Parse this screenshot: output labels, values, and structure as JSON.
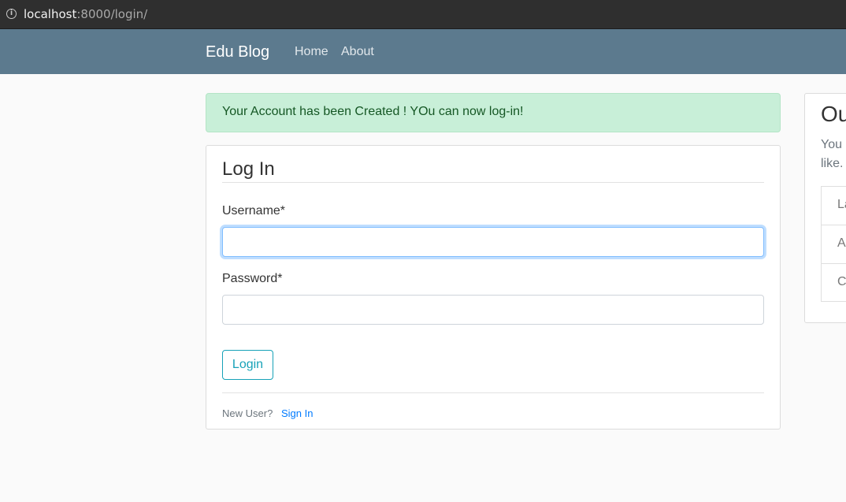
{
  "browser": {
    "url_host": "localhost",
    "url_path": ":8000/login/"
  },
  "navbar": {
    "brand": "Edu Blog",
    "links": [
      "Home",
      "About"
    ]
  },
  "alert": {
    "message": "Your Account has been Created ! YOu can now log-in!"
  },
  "login_form": {
    "legend": "Log In",
    "username_label": "Username*",
    "username_value": "",
    "password_label": "Password*",
    "password_value": "",
    "submit_label": "Login",
    "footer_text": "New User?",
    "signin_link": "Sign In"
  },
  "sidebar": {
    "title": "Ou",
    "text_line1": "You",
    "text_line2": "like.",
    "items": [
      "La",
      "A",
      "C"
    ]
  },
  "colors": {
    "navbar_bg": "#5c7a8e",
    "alert_bg": "#c8efd8",
    "alert_text": "#155724",
    "button_accent": "#17a2b8",
    "link": "#007bff"
  }
}
